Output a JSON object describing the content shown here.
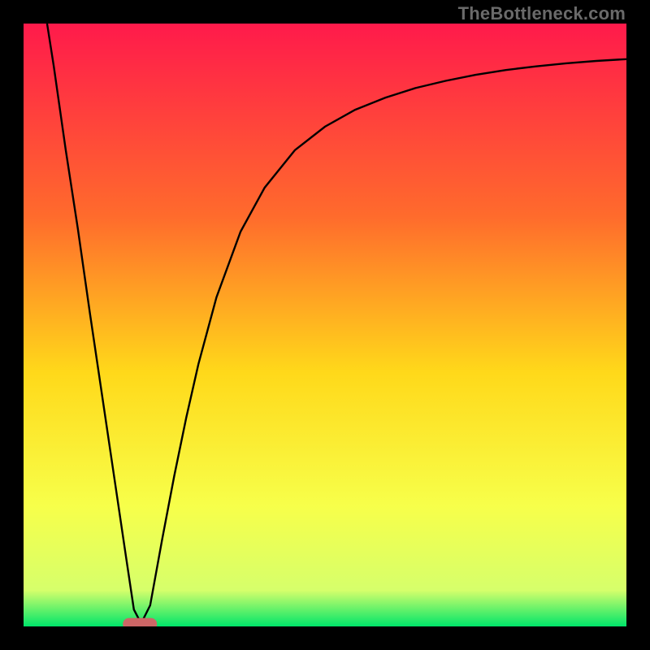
{
  "watermark": "TheBottleneck.com",
  "chart_data": {
    "type": "line",
    "title": "",
    "xlabel": "",
    "ylabel": "",
    "xlim": [
      0,
      100
    ],
    "ylim": [
      0,
      100
    ],
    "grid": false,
    "legend": false,
    "gradient_colors": {
      "top": "#ff1a4b",
      "mid_upper": "#ff6b2c",
      "mid": "#ffd91a",
      "mid_lower": "#f7ff4a",
      "near_bottom": "#d6ff6b",
      "bottom": "#00e56a"
    },
    "series": [
      {
        "name": "bottleneck-curve",
        "color": "#000000",
        "x": [
          3.9,
          5,
          7,
          9,
          11,
          13,
          15,
          17,
          18.3,
          19.5,
          21,
          23,
          25,
          27,
          29,
          32,
          36,
          40,
          45,
          50,
          55,
          60,
          65,
          70,
          75,
          80,
          85,
          90,
          95,
          100
        ],
        "y": [
          100,
          93,
          79,
          66,
          52,
          38.5,
          25,
          11.5,
          2.8,
          0.5,
          3.5,
          14.5,
          25,
          34.7,
          43.5,
          54.6,
          65.5,
          72.8,
          79,
          82.9,
          85.7,
          87.7,
          89.3,
          90.5,
          91.5,
          92.3,
          92.9,
          93.4,
          93.8,
          94.1
        ]
      }
    ],
    "marker": {
      "name": "optimal-point",
      "shape": "rounded-rect",
      "color": "#cc6666",
      "center_x": 19.3,
      "center_y": 0.4,
      "width_pct": 5.6,
      "height_pct": 2.0
    }
  }
}
